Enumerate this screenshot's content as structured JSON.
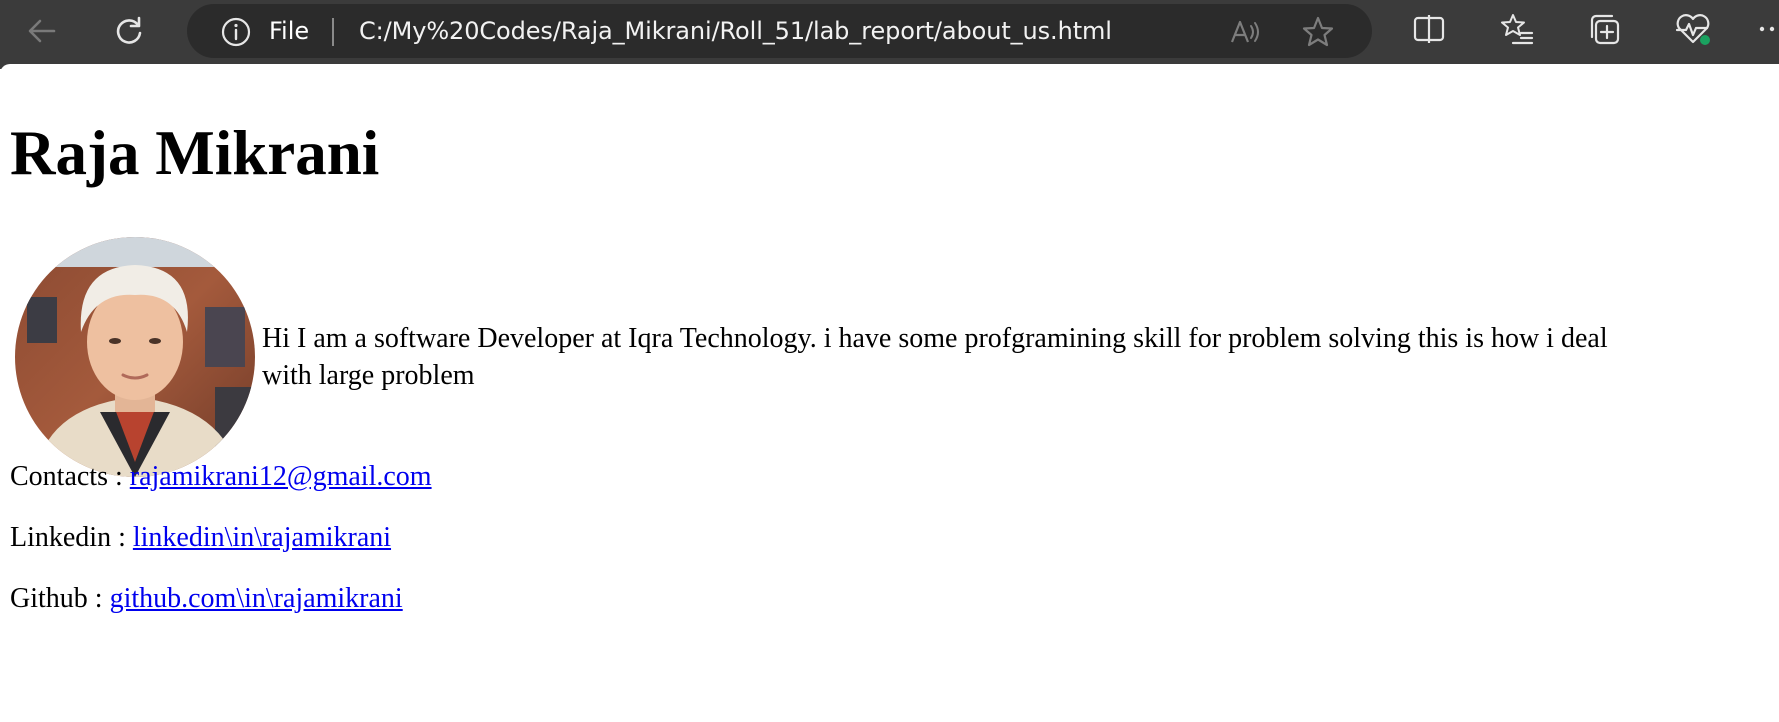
{
  "browser": {
    "address_scheme_label": "File",
    "url": "C:/My%20Codes/Raja_Mikrani/Roll_51/lab_report/about_us.html",
    "icons": {
      "back": "back-arrow-icon",
      "reload": "reload-icon",
      "site_info": "info-icon",
      "read_aloud": "read-aloud-icon",
      "favorite": "star-icon",
      "split_screen": "split-screen-icon",
      "favorites": "favorites-list-icon",
      "collections": "collections-icon",
      "browser_essentials": "heartbeat-icon",
      "more": "more-icon"
    },
    "colors": {
      "toolbar": "#3b3b3b",
      "omnibox": "#2b2b2b",
      "health_dot": "#1aa260"
    }
  },
  "page": {
    "title": "Raja Mikrani",
    "bio": "Hi I am a software Developer at Iqra Technology. i have some profgramining skill for problem solving this is how i deal with large problem",
    "bio_line1": "Hi I am a software Developer at Iqra Technology. i have some profgramining skill for problem solving this is how i deal",
    "bio_line2": "with large problem",
    "contacts": [
      {
        "label": "Contacts : ",
        "link_text": "rajamikrani12@gmail.com"
      },
      {
        "label": "Linkedin : ",
        "link_text": "linkedin\\in\\rajamikrani"
      },
      {
        "label": "Github : ",
        "link_text": "github.com\\in\\rajamikrani"
      }
    ],
    "colors": {
      "link": "#0000ee",
      "text": "#000000"
    }
  }
}
